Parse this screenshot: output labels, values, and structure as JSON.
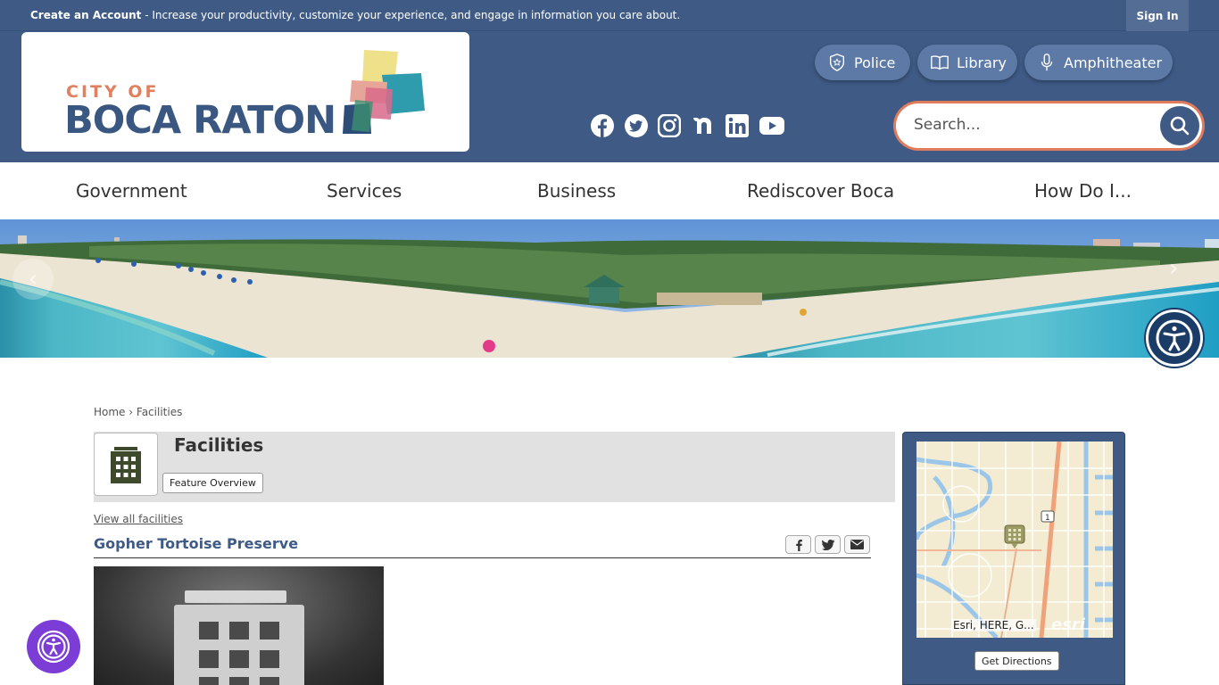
{
  "topbar": {
    "create_account_label": "Create an Account",
    "create_account_text": " - Increase your productivity, customize your experience, and engage in information you care about.",
    "sign_in": "Sign In"
  },
  "logo": {
    "city_of": "CITY OF",
    "name": "BOCA RATON"
  },
  "quick_links": [
    {
      "label": "Police",
      "icon": "police-badge-icon"
    },
    {
      "label": "Library",
      "icon": "book-icon"
    },
    {
      "label": "Amphitheater",
      "icon": "microphone-icon"
    }
  ],
  "social": [
    "facebook-icon",
    "twitter-icon",
    "instagram-icon",
    "nextdoor-icon",
    "linkedin-icon",
    "youtube-icon"
  ],
  "search": {
    "placeholder": "Search..."
  },
  "nav": {
    "items": [
      "Government",
      "Services",
      "Business",
      "Rediscover Boca",
      "How Do I..."
    ]
  },
  "breadcrumb": {
    "home": "Home",
    "separator": "›",
    "current": "Facilities"
  },
  "facilities": {
    "title": "Facilities",
    "feature_overview": "Feature Overview",
    "view_all": "View all facilities",
    "item_title": "Gopher Tortoise Preserve"
  },
  "map": {
    "attribution": "Esri, HERE, G...",
    "esri_logo": "esri",
    "get_directions": "Get Directions",
    "road_label": "1"
  },
  "colors": {
    "header_blue": "#3e5a85",
    "accent_orange": "#e07b5b",
    "purple_fab": "#7b3dd6"
  }
}
